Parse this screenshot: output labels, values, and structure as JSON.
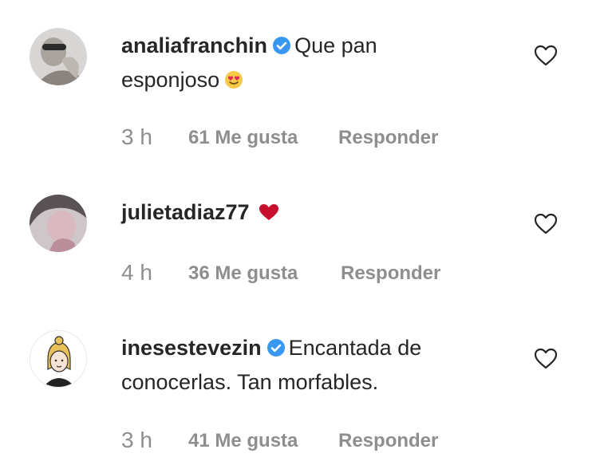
{
  "comments": [
    {
      "username": "analiafranchin",
      "verified": true,
      "text_line1": "Que pan",
      "text_line2": "esponjoso",
      "emoji": "smiling-face-with-heart-eyes",
      "time": "3 h",
      "likes": "61 Me gusta",
      "reply": "Responder"
    },
    {
      "username": "julietadiaz77",
      "verified": false,
      "text_line1": "",
      "emoji": "red-heart",
      "time": "4 h",
      "likes": "36 Me gusta",
      "reply": "Responder"
    },
    {
      "username": "inesestevezin",
      "verified": true,
      "text_line1": "Encantada de",
      "text_line2": "conocerlas. Tan morfables.",
      "time": "3 h",
      "likes": "41 Me gusta",
      "reply": "Responder"
    }
  ],
  "colors": {
    "text": "#262626",
    "meta": "#8e8e8e",
    "verified_blue": "#3897f0",
    "heart_red": "#c8102e"
  }
}
